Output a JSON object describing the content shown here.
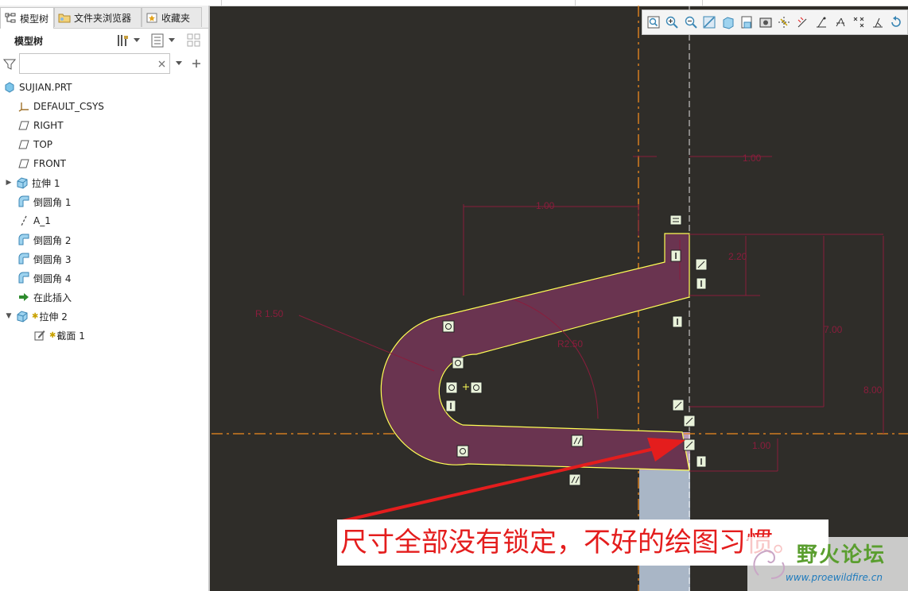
{
  "tabs": [
    {
      "label": "模型树",
      "icon": "model-tree-icon",
      "active": true
    },
    {
      "label": "文件夹浏览器",
      "icon": "folder-browser-icon",
      "active": false
    },
    {
      "label": "收藏夹",
      "icon": "favorites-icon",
      "active": false
    }
  ],
  "panel": {
    "title": "模型树"
  },
  "search": {
    "value": "",
    "placeholder": ""
  },
  "tree": [
    {
      "label": "SUJIAN.PRT",
      "icon": "part-icon",
      "depth": 0,
      "expander": ""
    },
    {
      "label": "DEFAULT_CSYS",
      "icon": "csys-icon",
      "depth": 1,
      "expander": ""
    },
    {
      "label": "RIGHT",
      "icon": "datum-plane-icon",
      "depth": 1,
      "expander": ""
    },
    {
      "label": "TOP",
      "icon": "datum-plane-icon",
      "depth": 1,
      "expander": ""
    },
    {
      "label": "FRONT",
      "icon": "datum-plane-icon",
      "depth": 1,
      "expander": ""
    },
    {
      "label": "拉伸 1",
      "icon": "extrude-icon",
      "depth": 1,
      "expander": "▶"
    },
    {
      "label": "倒圆角 1",
      "icon": "round-icon",
      "depth": 1,
      "expander": ""
    },
    {
      "label": "A_1",
      "icon": "axis-icon",
      "depth": 1,
      "expander": ""
    },
    {
      "label": "倒圆角 2",
      "icon": "round-icon",
      "depth": 1,
      "expander": ""
    },
    {
      "label": "倒圆角 3",
      "icon": "round-icon",
      "depth": 1,
      "expander": ""
    },
    {
      "label": "倒圆角 4",
      "icon": "round-icon",
      "depth": 1,
      "expander": ""
    },
    {
      "label": "在此插入",
      "icon": "insert-here-icon",
      "depth": 1,
      "expander": ""
    },
    {
      "label": "拉伸 2",
      "icon": "extrude-icon",
      "depth": 1,
      "expander": "▼",
      "new": true
    },
    {
      "label": "截面 1",
      "icon": "sketch-icon",
      "depth": 2,
      "expander": "",
      "new": true
    }
  ],
  "view_toolbar": [
    "refit-icon",
    "zoom-in-icon",
    "zoom-out-icon",
    "repaint-icon",
    "display-style-icon",
    "saved-views-icon",
    "view-manager-icon",
    "datum-display-icon",
    "dimension-display-icon",
    "constraint-display-icon",
    "grid-display-icon",
    "vertex-display-icon",
    "sketch-setup-icon",
    "rotate-icon"
  ],
  "annotation": {
    "text": "尺寸全部没有锁定，不好的绘图习惯。"
  },
  "watermark": {
    "name": "野火论坛",
    "url": "www.proewildfire.cn"
  },
  "colors": {
    "canvas": "#2f2d29",
    "sketch_line": "#ffff55",
    "dimension": "#8a1d3c",
    "centerline": "#f08a1e",
    "fill": "#6a3450",
    "arrow": "#e41d1d"
  }
}
